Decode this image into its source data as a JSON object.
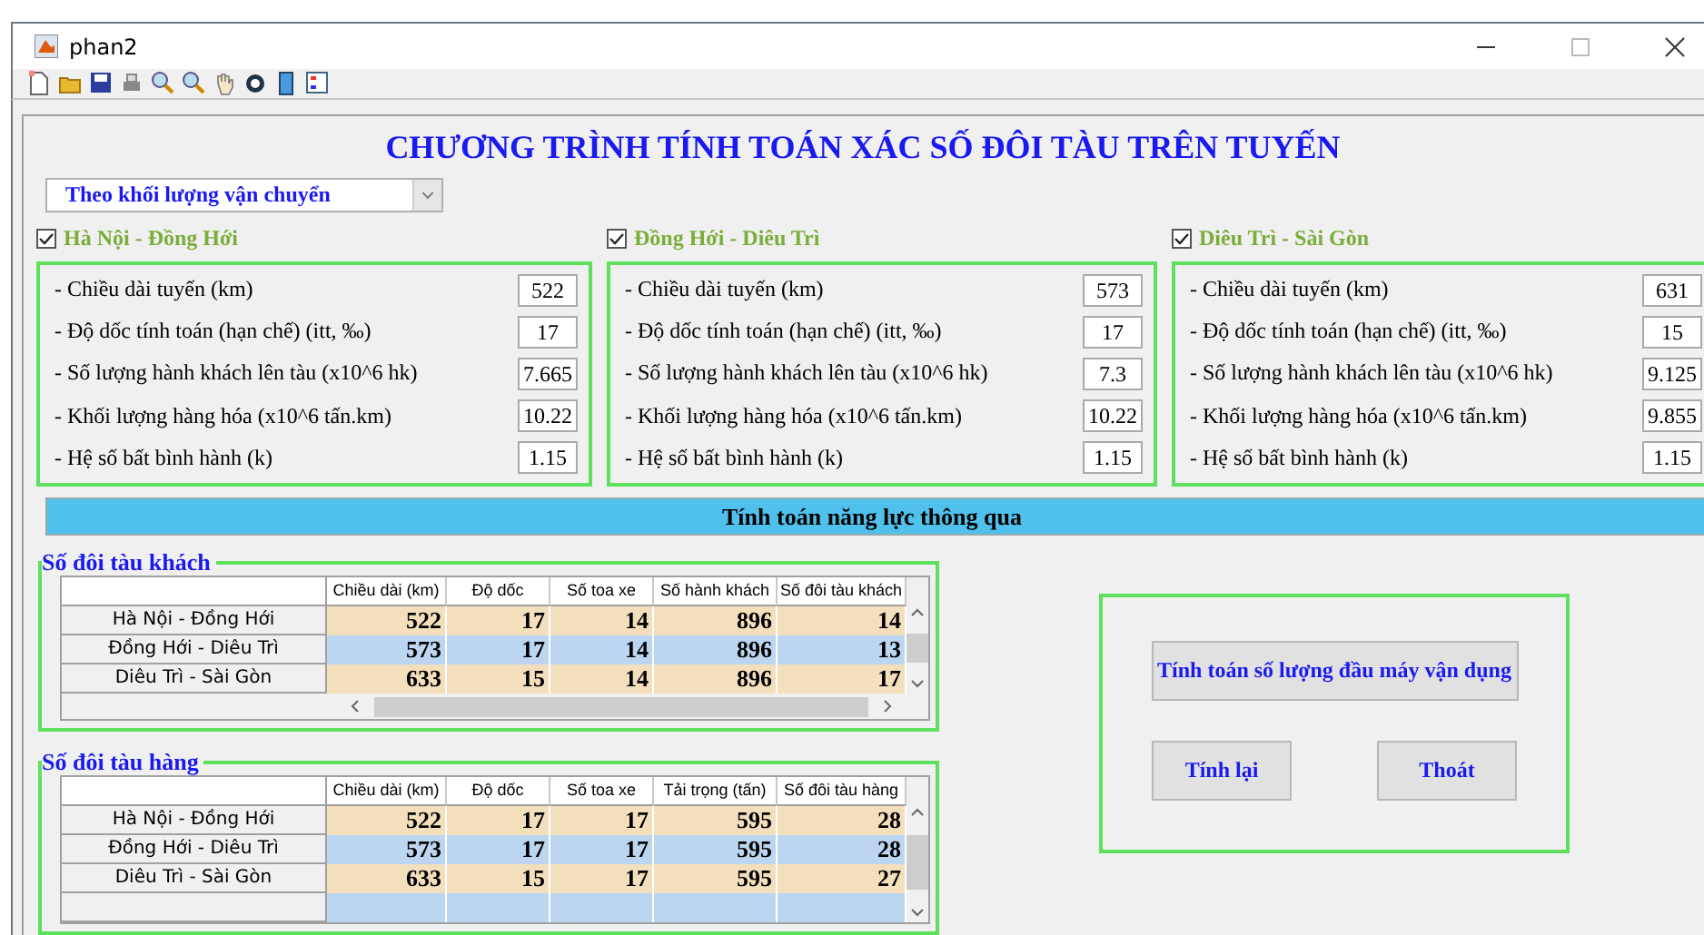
{
  "window": {
    "title": "phan2"
  },
  "heading": "CHƯƠNG TRÌNH TÍNH TOÁN XÁC SỐ ĐÔI TÀU TRÊN TUYẾN",
  "mode_dropdown": {
    "value": "Theo khối lượng vận chuyển"
  },
  "routes": [
    {
      "name": "Hà Nội - Đồng Hới",
      "checked": true,
      "fields": [
        {
          "label": "- Chiều dài tuyến (km)",
          "value": "522"
        },
        {
          "label": "- Độ dốc tính toán (hạn chế) (itt, ‰)",
          "value": "17"
        },
        {
          "label": "- Số lượng hành khách lên tàu (x10^6 hk)",
          "value": "7.665"
        },
        {
          "label": "- Khối lượng hàng hóa (x10^6 tấn.km)",
          "value": "10.22"
        },
        {
          "label": "- Hệ số bất bình hành (k)",
          "value": "1.15"
        }
      ]
    },
    {
      "name": "Đồng Hới - Diêu Trì",
      "checked": true,
      "fields": [
        {
          "label": "- Chiều dài tuyến (km)",
          "value": "573"
        },
        {
          "label": "- Độ dốc tính toán (hạn chế) (itt, ‰)",
          "value": "17"
        },
        {
          "label": "- Số lượng hành khách lên tàu (x10^6 hk)",
          "value": "7.3"
        },
        {
          "label": "- Khối lượng hàng hóa (x10^6 tấn.km)",
          "value": "10.22"
        },
        {
          "label": "- Hệ số bất bình hành (k)",
          "value": "1.15"
        }
      ]
    },
    {
      "name": "Diêu Trì - Sài Gòn",
      "checked": true,
      "fields": [
        {
          "label": "- Chiều dài tuyến (km)",
          "value": "631"
        },
        {
          "label": "- Độ dốc tính toán (hạn chế) (itt, ‰)",
          "value": "15"
        },
        {
          "label": "- Số lượng hành khách lên tàu (x10^6 hk)",
          "value": "9.125"
        },
        {
          "label": "- Khối lượng hàng hóa (x10^6 tấn.km)",
          "value": "9.855"
        },
        {
          "label": "- Hệ số bất bình hành (k)",
          "value": "1.15"
        }
      ]
    }
  ],
  "compute_button": "Tính toán năng lực thông qua",
  "tables": [
    {
      "title": "Số đôi tàu khách",
      "horizontal_scroll": true,
      "columns": [
        "Chiều dài (km)",
        "Độ dốc",
        "Số toa xe",
        "Số hành khách",
        "Số đôi tàu khách"
      ],
      "rows": [
        {
          "label": "Hà Nội - Đồng Hới",
          "cells": [
            "522",
            "17",
            "14",
            "896",
            "14"
          ]
        },
        {
          "label": "Đồng Hới - Diêu Trì",
          "cells": [
            "573",
            "17",
            "14",
            "896",
            "13"
          ]
        },
        {
          "label": "Diêu Trì - Sài Gòn",
          "cells": [
            "633",
            "15",
            "14",
            "896",
            "17"
          ]
        }
      ]
    },
    {
      "title": "Số đôi tàu hàng",
      "horizontal_scroll": false,
      "columns": [
        "Chiều dài (km)",
        "Độ dốc",
        "Số toa xe",
        "Tải trọng (tấn)",
        "Số đôi tàu hàng"
      ],
      "rows": [
        {
          "label": "Hà Nội - Đồng Hới",
          "cells": [
            "522",
            "17",
            "17",
            "595",
            "28"
          ]
        },
        {
          "label": "Đồng Hới - Diêu Trì",
          "cells": [
            "573",
            "17",
            "17",
            "595",
            "28"
          ]
        },
        {
          "label": "Diêu Trì - Sài Gòn",
          "cells": [
            "633",
            "15",
            "17",
            "595",
            "27"
          ]
        },
        {
          "label": "",
          "cells": [
            "",
            "",
            "",
            "",
            ""
          ]
        }
      ]
    }
  ],
  "actions": {
    "locomotive_button": "Tính toán số lượng đầu máy vận dụng",
    "recalc_button": "Tính lại",
    "exit_button": "Thoát"
  }
}
